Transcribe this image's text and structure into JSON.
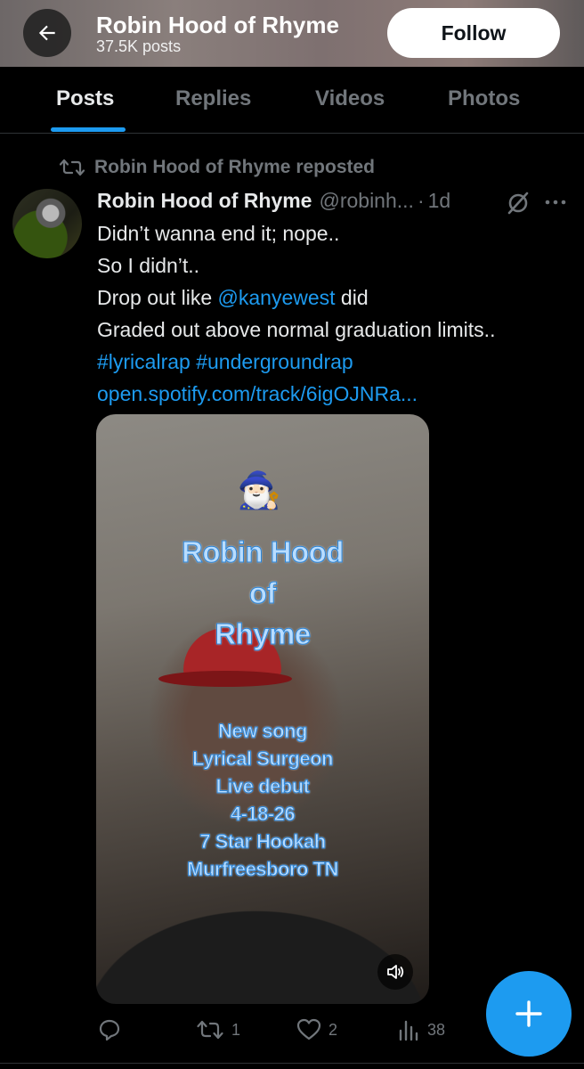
{
  "header": {
    "title": "Robin Hood of Rhyme",
    "subtitle": "37.5K posts",
    "follow_label": "Follow"
  },
  "tabs": [
    {
      "label": "Posts",
      "active": true
    },
    {
      "label": "Replies",
      "active": false
    },
    {
      "label": "Videos",
      "active": false
    },
    {
      "label": "Photos",
      "active": false
    }
  ],
  "post": {
    "repost_label": "Robin Hood of Rhyme reposted",
    "author_name": "Robin Hood of Rhyme",
    "handle": "@robinh...",
    "dot": "·",
    "time": "1d",
    "text": {
      "line1": "Didn’t wanna end it; nope..",
      "line2": "So I didn’t..",
      "line3_pre": "Drop out like ",
      "mention": "@kanyewest",
      "line3_post": "  did",
      "line4": "Graded out above normal graduation limits..",
      "hashtag1": "#lyricalrap",
      "hashtag2": "#undergroundrap",
      "link": "open.spotify.com/track/6igOJNRa..."
    },
    "media": {
      "overlay_title": [
        "Robin Hood",
        "of",
        "Rhyme"
      ],
      "overlay_details": [
        "New song",
        "Lyrical Surgeon",
        "Live debut",
        "4-18-26",
        "7 Star Hookah",
        "Murfreesboro TN"
      ],
      "wizard_emoji": "🧙🏻‍♂️"
    },
    "actions": {
      "reply_count": "",
      "repost_count": "1",
      "like_count": "2",
      "views_count": "38"
    }
  },
  "colors": {
    "accent": "#1d9bf0",
    "muted": "#71767b",
    "text": "#e7e9ea",
    "background": "#000000"
  },
  "icons": [
    "back-arrow-icon",
    "repost-icon",
    "grok-icon",
    "more-icon",
    "sound-icon",
    "reply-icon",
    "retweet-icon",
    "like-icon",
    "views-icon",
    "plus-icon"
  ]
}
